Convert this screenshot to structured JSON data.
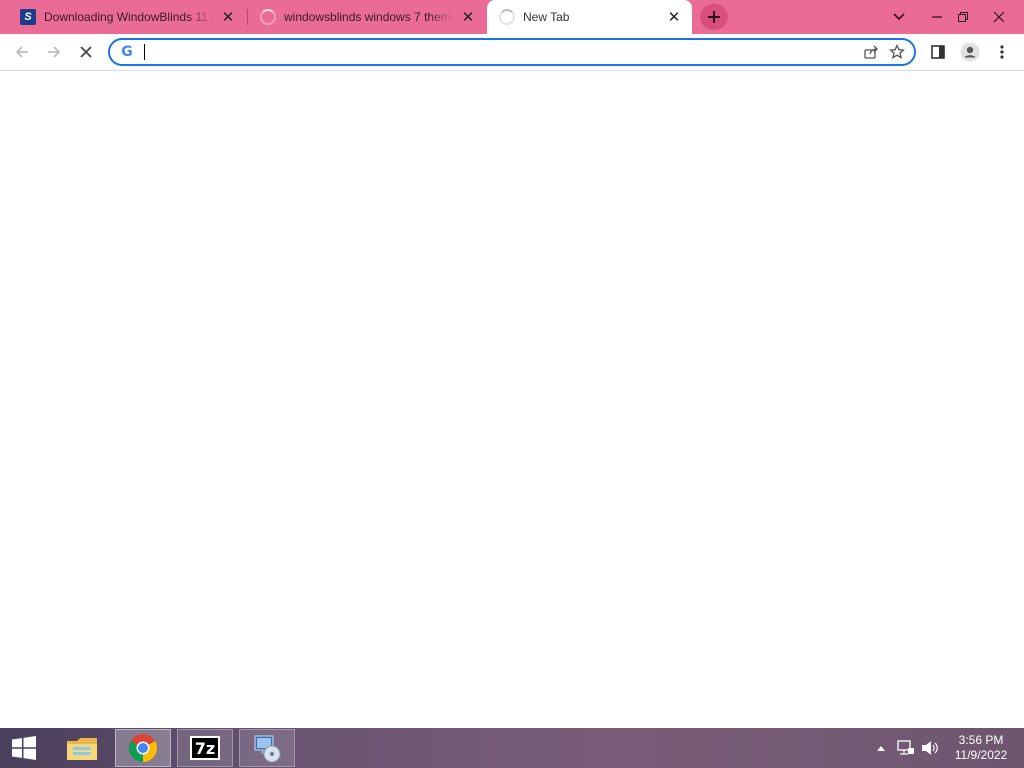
{
  "browser": {
    "tabs": [
      {
        "title": "Downloading WindowBlinds 11 |",
        "favicon": "stardock-icon"
      },
      {
        "title": "windowsblinds windows 7 theme",
        "favicon": "loading-spinner-icon"
      },
      {
        "title": "New Tab",
        "favicon": "loading-spinner-icon",
        "active": true
      }
    ],
    "address_bar": {
      "value": "",
      "placeholder": ""
    },
    "colors": {
      "tabstrip": "#ea6c96",
      "focus_ring": "#1a73e8"
    }
  },
  "taskbar": {
    "pinned": [
      {
        "name": "start-button"
      },
      {
        "name": "file-explorer-icon"
      },
      {
        "name": "chrome-icon",
        "active": true
      },
      {
        "name": "7zip-icon"
      },
      {
        "name": "setup-disc-icon"
      }
    ],
    "clock": {
      "time": "3:56 PM",
      "date": "11/9/2022"
    }
  }
}
